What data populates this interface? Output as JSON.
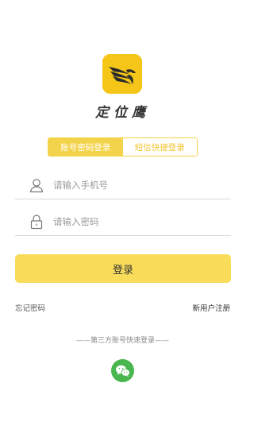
{
  "app": {
    "name": "定位鹰",
    "logo_icon": "eagle-logo-icon",
    "brand_color": "#f5c518"
  },
  "tabs": [
    {
      "label": "账号密码登录",
      "active": true
    },
    {
      "label": "短信快捷登录",
      "active": false
    }
  ],
  "fields": {
    "phone": {
      "placeholder": "请输入手机号",
      "value": "",
      "icon": "user-icon"
    },
    "password": {
      "placeholder": "请输入密码",
      "value": "",
      "icon": "lock-icon"
    }
  },
  "actions": {
    "login_label": "登录",
    "forgot_label": "忘记密码",
    "register_label": "新用户注册"
  },
  "third_party": {
    "label": "——第三方账号快速登录——",
    "providers": [
      {
        "icon": "wechat-icon",
        "color": "#49b64f"
      }
    ]
  }
}
